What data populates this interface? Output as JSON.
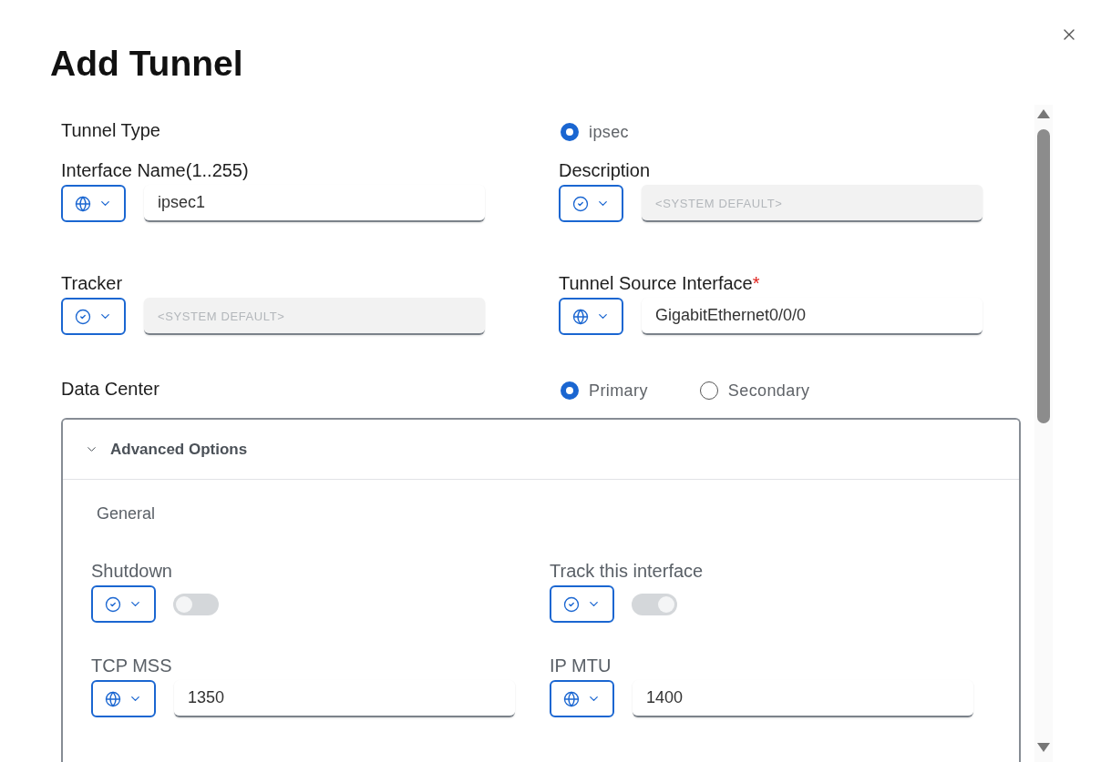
{
  "dialog": {
    "title": "Add Tunnel"
  },
  "tunnel_type": {
    "label": "Tunnel Type",
    "options": [
      {
        "label": "ipsec",
        "selected": true
      }
    ]
  },
  "fields": [
    {
      "label": "Interface Name(1..255)",
      "scope": {
        "kind": "global"
      },
      "value": "ipsec1",
      "disabled": false
    },
    {
      "label": "Description",
      "scope": {
        "kind": "default"
      },
      "placeholder": "<SYSTEM DEFAULT>",
      "disabled": true
    },
    {
      "label": "Tracker",
      "scope": {
        "kind": "default"
      },
      "placeholder": "<SYSTEM DEFAULT>",
      "disabled": true
    },
    {
      "label": "Tunnel Source Interface",
      "required_mark": "*",
      "scope": {
        "kind": "global"
      },
      "value": "GigabitEthernet0/0/0",
      "disabled": false
    }
  ],
  "data_center": {
    "label": "Data Center",
    "options": [
      {
        "label": "Primary",
        "selected": true
      },
      {
        "label": "Secondary",
        "selected": false
      }
    ]
  },
  "advanced_options": {
    "title": "Advanced Options",
    "expanded": true,
    "section_title": "General",
    "items": [
      {
        "kind": "toggle",
        "label": "Shutdown",
        "scope": {
          "kind": "default"
        },
        "on": false,
        "disabled": true
      },
      {
        "kind": "toggle",
        "label": "Track this interface",
        "scope": {
          "kind": "default"
        },
        "on": true,
        "disabled": true
      },
      {
        "kind": "text",
        "label": "TCP MSS",
        "scope": {
          "kind": "global"
        },
        "value": "1350",
        "disabled": false
      },
      {
        "kind": "text",
        "label": "IP MTU",
        "scope": {
          "kind": "global"
        },
        "value": "1400",
        "disabled": false
      }
    ]
  }
}
